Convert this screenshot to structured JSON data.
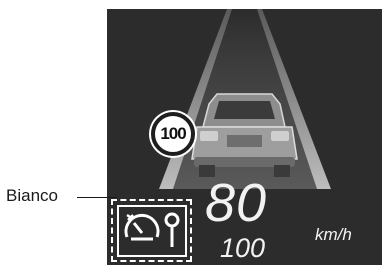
{
  "callout": {
    "label": "Bianco"
  },
  "hud": {
    "current_speed": "80",
    "set_speed": "100",
    "unit": "km/h",
    "speed_sign": "100"
  },
  "colors": {
    "display_bg": "#2c2c2c",
    "text": "#f2f2f2",
    "icon_white": "#ffffff"
  },
  "icons": [
    "speedometer-icon",
    "lane-keep-icon"
  ]
}
